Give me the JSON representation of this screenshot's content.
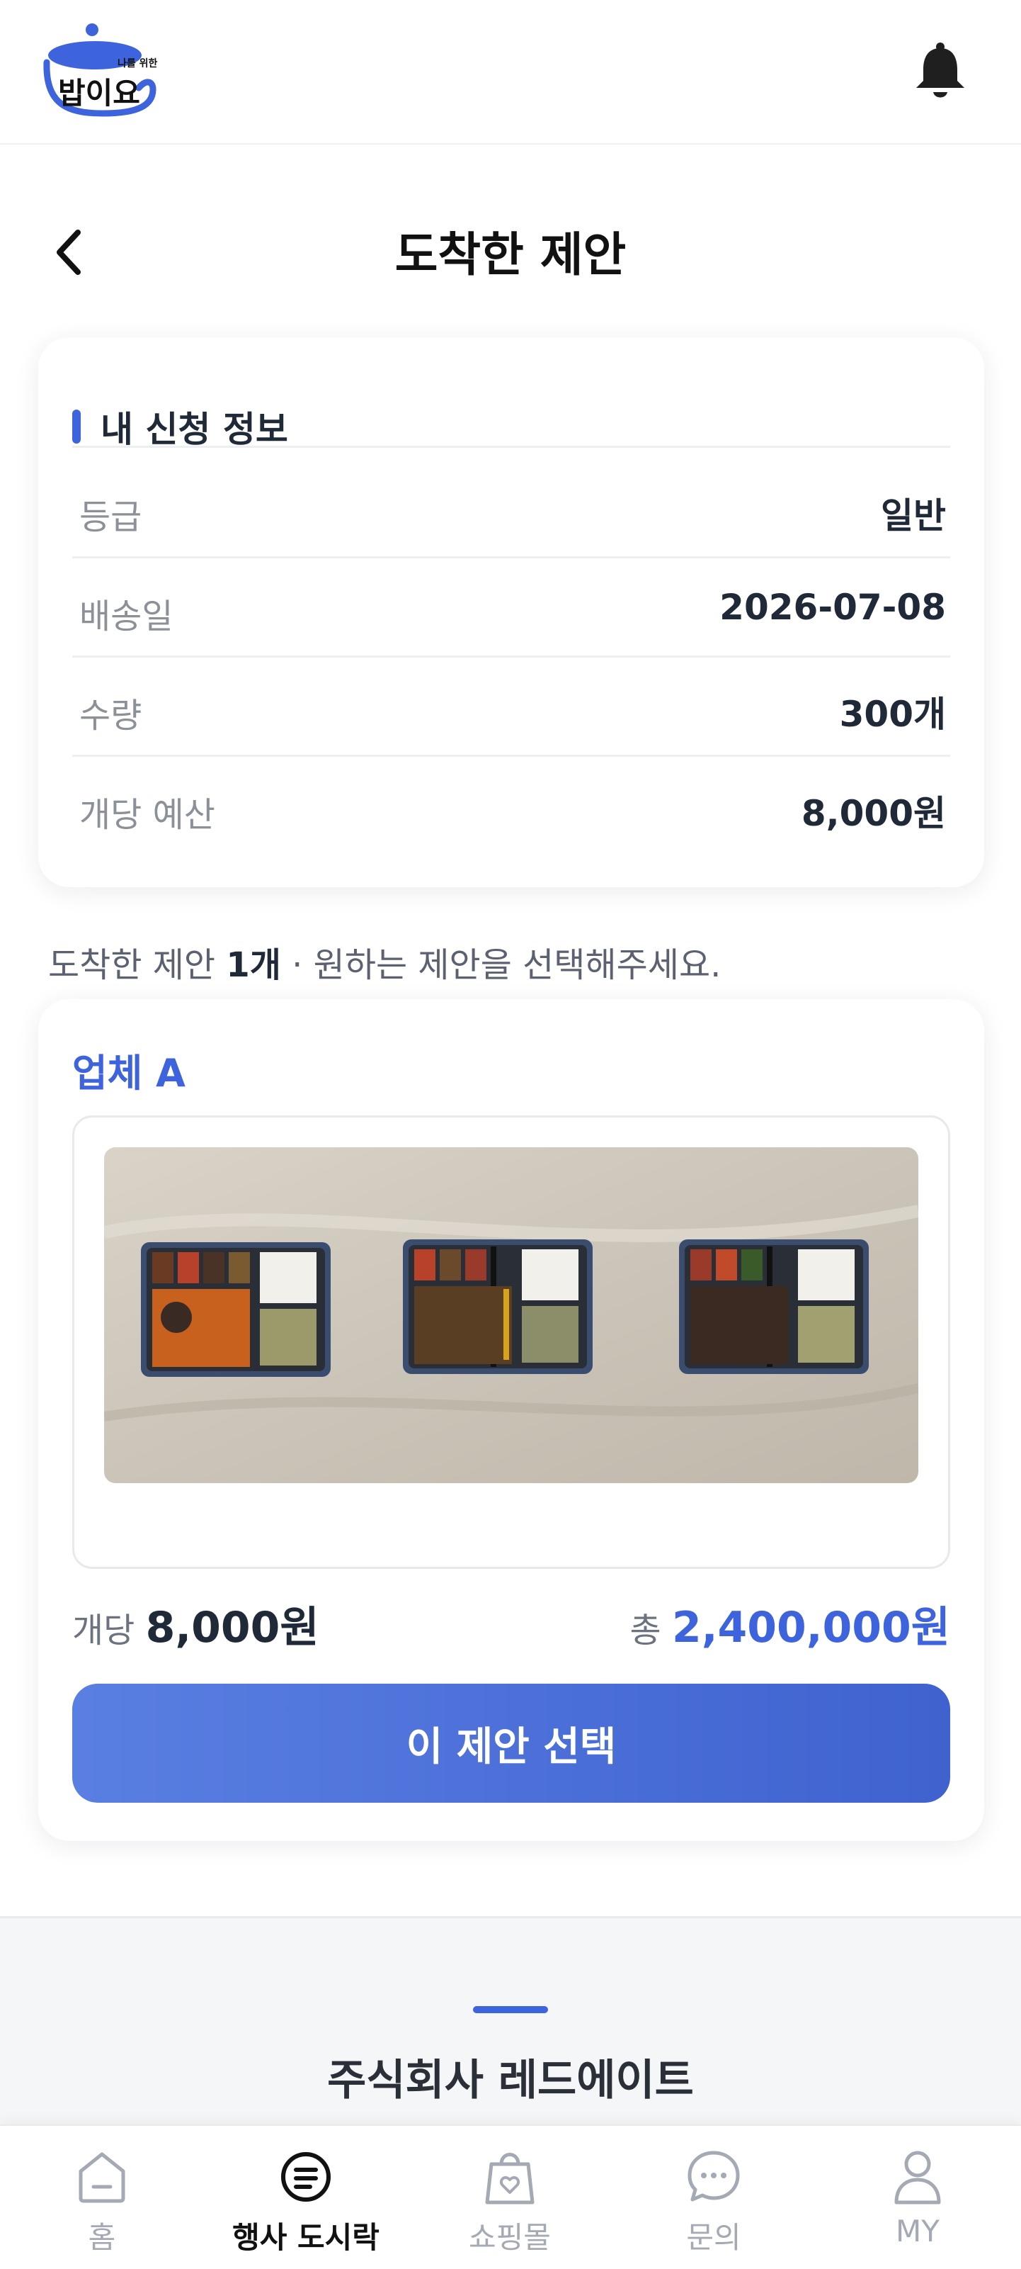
{
  "logo": {
    "small_text": "나를 위한",
    "main_text": "밥이요"
  },
  "header": {
    "title": "도착한 제안",
    "back_icon": "chevron-left-icon",
    "bell_icon": "bell-icon"
  },
  "info": {
    "title": "내 신청 정보",
    "rows": [
      {
        "label": "등급",
        "value": "일반"
      },
      {
        "label": "배송일",
        "value": "2026-07-08"
      },
      {
        "label": "수량",
        "value": "300개"
      },
      {
        "label": "개당 예산",
        "value": "8,000원"
      }
    ]
  },
  "notice": {
    "prefix": "도착한 제안 ",
    "count": "1개",
    "suffix": " · 원하는 제안을 선택해주세요."
  },
  "offer": {
    "vendor": "업체 A",
    "unit_label": "개당 ",
    "unit_price": "8,000원",
    "total_label": "총 ",
    "total_price": "2,400,000원",
    "select_label": "이 제안 선택"
  },
  "footer": {
    "company": "주식회사 레드에이트"
  },
  "nav": [
    {
      "label": "홈",
      "icon": "home-icon",
      "active": false
    },
    {
      "label": "행사 도시락",
      "icon": "lunchbox-icon",
      "active": true
    },
    {
      "label": "쇼핑몰",
      "icon": "shopping-bag-icon",
      "active": false
    },
    {
      "label": "문의",
      "icon": "chat-icon",
      "active": false
    },
    {
      "label": "MY",
      "icon": "user-icon",
      "active": false
    }
  ],
  "colors": {
    "accent": "#3d63dd",
    "text": "#1f2937",
    "muted": "#8b9099"
  }
}
